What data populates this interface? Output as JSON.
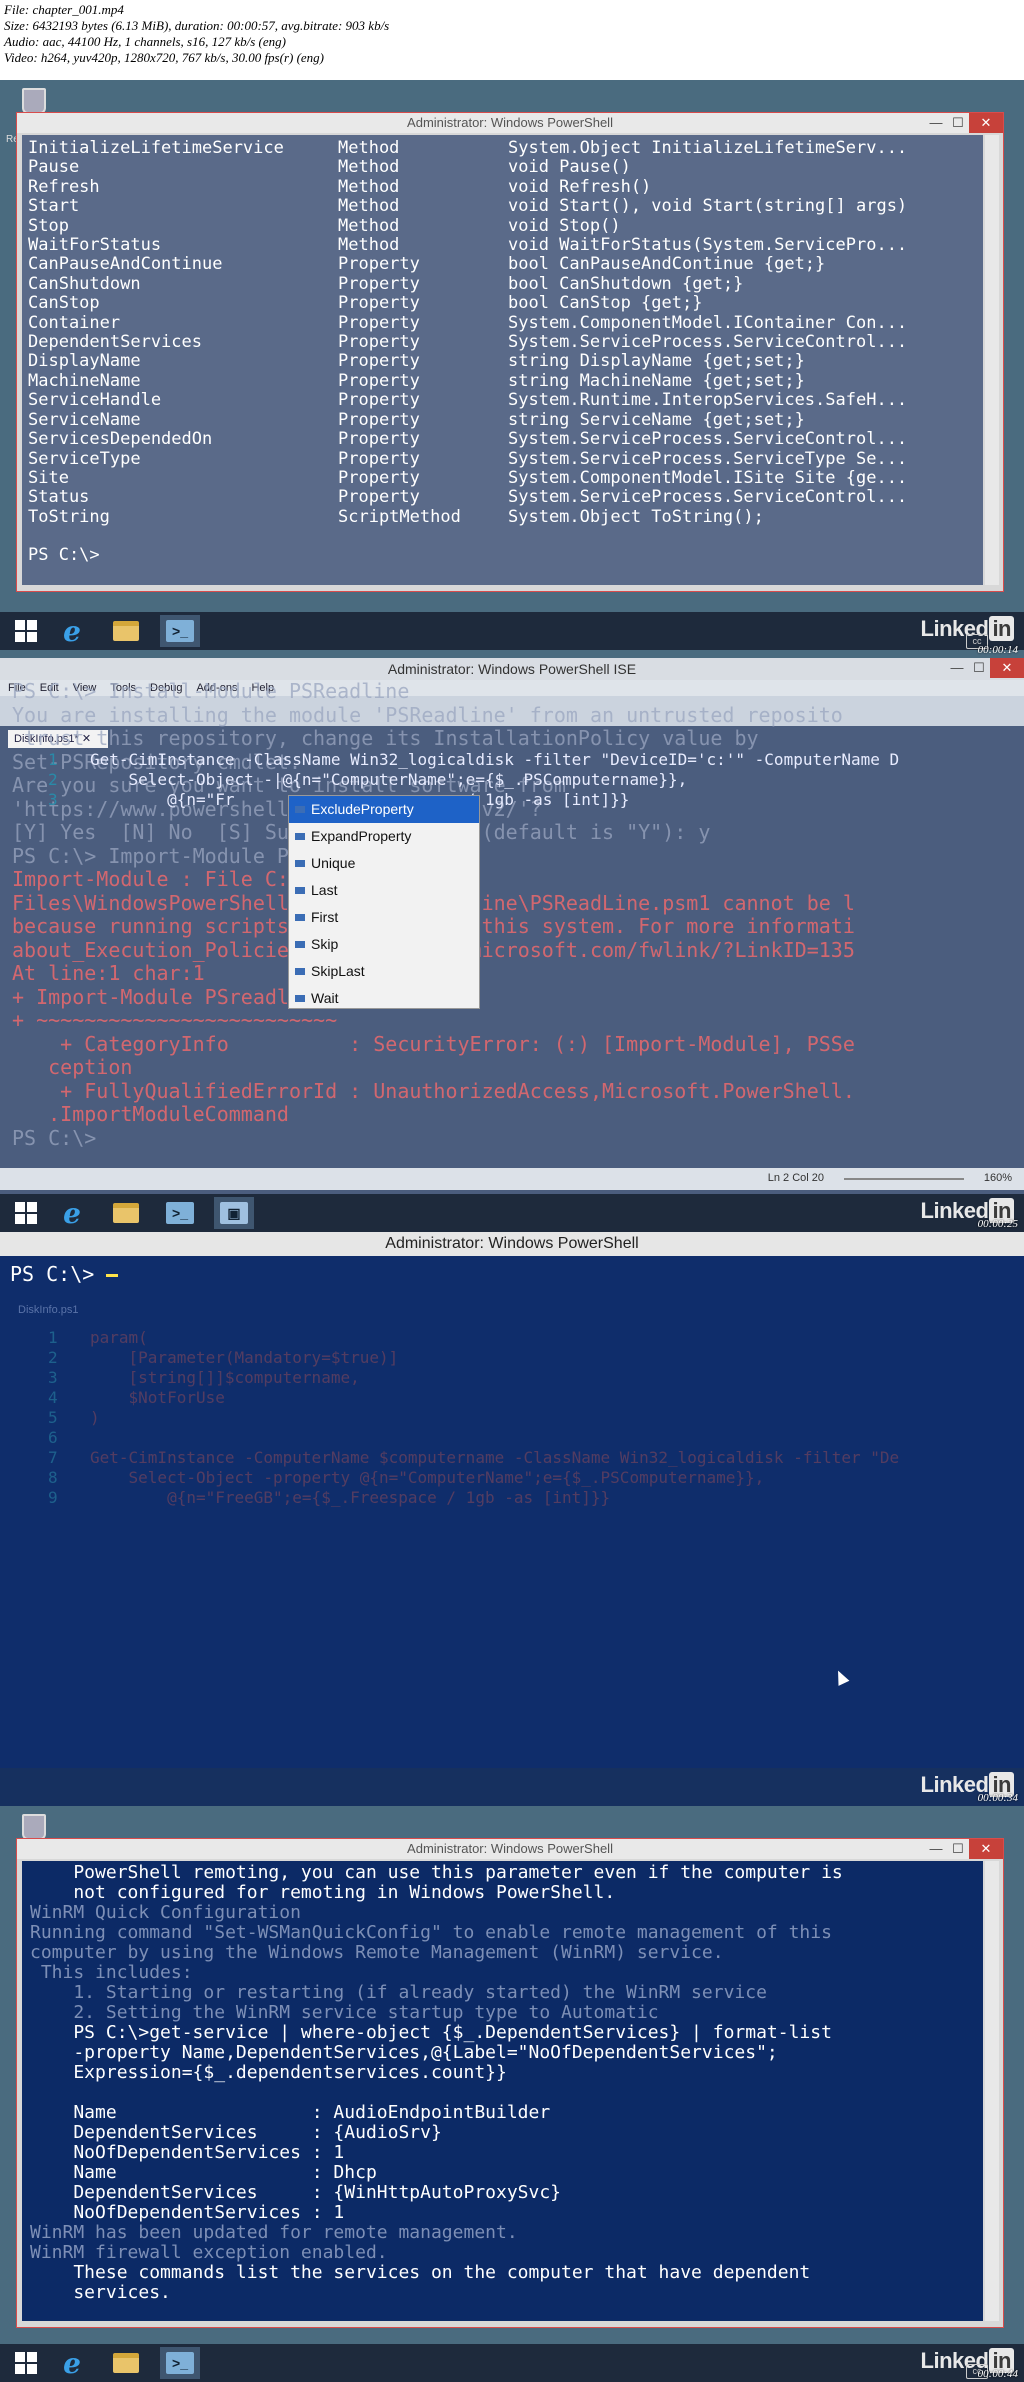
{
  "file_info": [
    "File: chapter_001.mp4",
    "Size: 6432193 bytes (6.13 MiB), duration: 00:00:57, avg.bitrate: 903 kb/s",
    "Audio: aac, 44100 Hz, 1 channels, s16, 127 kb/s (eng)",
    "Video: h264, yuv420p, 1280x720, 767 kb/s, 30.00 fps(r) (eng)"
  ],
  "frame1": {
    "title": "Administrator: Windows PowerShell",
    "timestamp": "00:00:14",
    "rows": [
      [
        "InitializeLifetimeService",
        "Method",
        "System.Object InitializeLifetimeServ..."
      ],
      [
        "Pause",
        "Method",
        "void Pause()"
      ],
      [
        "Refresh",
        "Method",
        "void Refresh()"
      ],
      [
        "Start",
        "Method",
        "void Start(), void Start(string[] args)"
      ],
      [
        "Stop",
        "Method",
        "void Stop()"
      ],
      [
        "WaitForStatus",
        "Method",
        "void WaitForStatus(System.ServicePro..."
      ],
      [
        "CanPauseAndContinue",
        "Property",
        "bool CanPauseAndContinue {get;}"
      ],
      [
        "CanShutdown",
        "Property",
        "bool CanShutdown {get;}"
      ],
      [
        "CanStop",
        "Property",
        "bool CanStop {get;}"
      ],
      [
        "Container",
        "Property",
        "System.ComponentModel.IContainer Con..."
      ],
      [
        "DependentServices",
        "Property",
        "System.ServiceProcess.ServiceControl..."
      ],
      [
        "DisplayName",
        "Property",
        "string DisplayName {get;set;}"
      ],
      [
        "MachineName",
        "Property",
        "string MachineName {get;set;}"
      ],
      [
        "ServiceHandle",
        "Property",
        "System.Runtime.InteropServices.SafeH..."
      ],
      [
        "ServiceName",
        "Property",
        "string ServiceName {get;set;}"
      ],
      [
        "ServicesDependedOn",
        "Property",
        "System.ServiceProcess.ServiceControl..."
      ],
      [
        "ServiceType",
        "Property",
        "System.ServiceProcess.ServiceType Se..."
      ],
      [
        "Site",
        "Property",
        "System.ComponentModel.ISite Site {ge..."
      ],
      [
        "Status",
        "Property",
        "System.ServiceProcess.ServiceControl..."
      ],
      [
        "ToString",
        "ScriptMethod",
        "System.Object ToString();"
      ]
    ],
    "prompt": "PS C:\\>"
  },
  "frame2": {
    "title": "Administrator: Windows PowerShell ISE",
    "timestamp": "00:00:25",
    "menu": [
      "File",
      "Edit",
      "View",
      "Tools",
      "Debug",
      "Add-ons",
      "Help"
    ],
    "tab": "DiskInfo.ps1*",
    "code_lines": [
      {
        "n": "1",
        "text": "Get-CimInstance -ClassName Win32_logicaldisk -filter \"DeviceID='c:'\" -ComputerName D"
      },
      {
        "n": "2",
        "text": "    Select-Object -|@{n=\"ComputerName\";e={$_.PSComputername}},"
      },
      {
        "n": "3",
        "text": "        @{n=\"Fr                    ace / 1gb -as [int]}}"
      }
    ],
    "ghost_lines": [
      {
        "t": "PS C:\\> Install-Module PSReadline",
        "err": false
      },
      {
        "t": "You are installing the module 'PSReadline' from an untrusted reposito",
        "err": false
      },
      {
        "t": " trust this repository, change its InstallationPolicy value by",
        "err": false
      },
      {
        "t": "Set-PSRepository cmdlet.",
        "err": false
      },
      {
        "t": "Are you sure you want to install software from",
        "err": false
      },
      {
        "t": "'https://www.powershellgallery.com/api/v2/'?",
        "err": false
      },
      {
        "t": "[Y] Yes  [N] No  [S] Suspend  [?] Help (default is \"Y\"): y",
        "err": false
      },
      {
        "t": "PS C:\\> Import-Module PSreadline",
        "err": false
      },
      {
        "t": "Import-Module : File C:\\Program",
        "err": true
      },
      {
        "t": "Files\\WindowsPowerShell\\Modules\\PSreadline\\PSReadLine.psm1 cannot be l",
        "err": true
      },
      {
        "t": "because running scripts is disabled on this system. For more informati",
        "err": true
      },
      {
        "t": "about_Execution_Policies at http://go.microsoft.com/fwlink/?LinkID=135",
        "err": true
      },
      {
        "t": "At line:1 char:1",
        "err": true
      },
      {
        "t": "+ Import-Module PSreadline",
        "err": true
      },
      {
        "t": "+ ~~~~~~~~~~~~~~~~~~~~~~~~~",
        "err": true
      },
      {
        "t": "    + CategoryInfo          : SecurityError: (:) [Import-Module], PSSe",
        "err": true
      },
      {
        "t": "   ception",
        "err": true
      },
      {
        "t": "    + FullyQualifiedErrorId : UnauthorizedAccess,Microsoft.PowerShell.",
        "err": true
      },
      {
        "t": "   .ImportModuleCommand",
        "err": true
      },
      {
        "t": "PS C:\\>",
        "err": false
      }
    ],
    "intellisense": [
      "ExcludeProperty",
      "ExpandProperty",
      "Unique",
      "Last",
      "First",
      "Skip",
      "SkipLast",
      "Wait"
    ],
    "status": "Ln 2  Col 20",
    "zoom": "160%"
  },
  "frame3": {
    "title": "Administrator: Windows PowerShell",
    "timestamp": "00:00:34",
    "prompt": "PS C:\\>",
    "ghost_code": [
      {
        "n": "1",
        "t": "param("
      },
      {
        "n": "2",
        "t": "    [Parameter(Mandatory=$true)]"
      },
      {
        "n": "3",
        "t": "    [string[]]$computername,"
      },
      {
        "n": "4",
        "t": "    $NotForUse"
      },
      {
        "n": "5",
        "t": ")"
      },
      {
        "n": "6",
        "t": ""
      },
      {
        "n": "7",
        "t": "Get-CimInstance -ComputerName $computername -ClassName Win32_logicaldisk -filter \"De"
      },
      {
        "n": "8",
        "t": "    Select-Object -property @{n=\"ComputerName\";e={$_.PSComputername}},"
      },
      {
        "n": "9",
        "t": "        @{n=\"FreeGB\";e={$_.Freespace / 1gb -as [int]}}"
      }
    ],
    "ghost_tab": "DiskInfo.ps1"
  },
  "frame4": {
    "title": "Administrator: Windows PowerShell",
    "timestamp": "00:00:44",
    "lines": [
      {
        "t": "    PowerShell remoting, you can use this parameter even if the computer is",
        "dim": false
      },
      {
        "t": "    not configured for remoting in Windows PowerShell.",
        "dim": false
      },
      {
        "t": "WinRM Quick Configuration",
        "dim": true
      },
      {
        "t": "Running command \"Set-WSManQuickConfig\" to enable remote management of this",
        "dim": true
      },
      {
        "t": "computer by using the Windows Remote Management (WinRM) service.",
        "dim": true
      },
      {
        "t": " This includes:",
        "dim": true
      },
      {
        "t": "    1. Starting or restarting (if already started) the WinRM service",
        "dim": true
      },
      {
        "t": "    2. Setting the WinRM service startup type to Automatic",
        "dim": true
      },
      {
        "t": "    PS C:\\>get-service | where-object {$_.DependentServices} | format-list",
        "dim": false
      },
      {
        "t": "    -property Name,DependentServices,@{Label=\"NoOfDependentServices\";",
        "dim": false
      },
      {
        "t": "    Expression={$_.dependentservices.count}}",
        "dim": false
      },
      {
        "t": "",
        "dim": false
      },
      {
        "t": "    Name                  : AudioEndpointBuilder",
        "dim": false
      },
      {
        "t": "    DependentServices     : {AudioSrv}",
        "dim": false
      },
      {
        "t": "    NoOfDependentServices : 1",
        "dim": false
      },
      {
        "t": "    Name                  : Dhcp",
        "dim": false
      },
      {
        "t": "    DependentServices     : {WinHttpAutoProxySvc}",
        "dim": false
      },
      {
        "t": "    NoOfDependentServices : 1",
        "dim": false
      },
      {
        "t": "WinRM has been updated for remote management.",
        "dim": true
      },
      {
        "t": "WinRM firewall exception enabled.",
        "dim": true
      },
      {
        "t": "    These commands list the services on the computer that have dependent",
        "dim": false
      },
      {
        "t": "    services.",
        "dim": false
      }
    ]
  },
  "brand": "Linked",
  "brand_in": "in",
  "desktop_label": "Re"
}
